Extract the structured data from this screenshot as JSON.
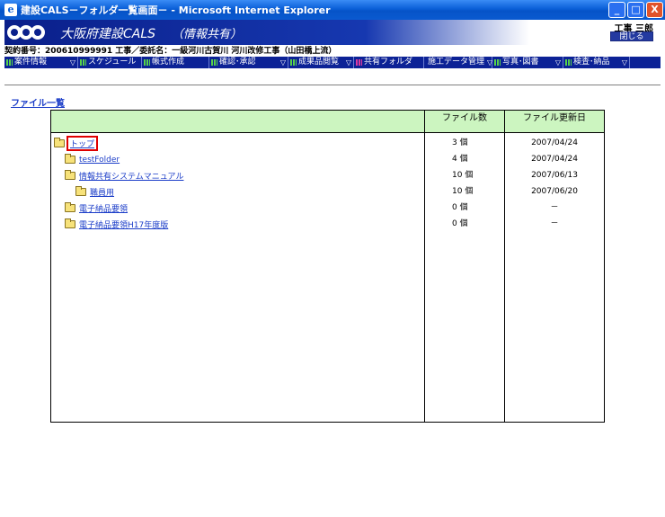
{
  "window": {
    "title": "建設CALS－フォルダ一覧画面－ - Microsoft Internet Explorer",
    "minimize": "_",
    "maximize": "□",
    "close": "X"
  },
  "header": {
    "app_title": "大阪府建設CALS",
    "app_subtitle": "（情報共有）",
    "user_name": "工事 三郎",
    "logout_label": "閉じる"
  },
  "contract_line": "契約番号：200610999991 工事／委託名：一級河川古賀川 河川改修工事（山田橋上流）",
  "menu": [
    {
      "label": "案件情報",
      "arrow": "▽",
      "active": false
    },
    {
      "label": "スケジュール",
      "arrow": "",
      "active": false
    },
    {
      "label": "帳式作成",
      "arrow": "",
      "active": false
    },
    {
      "label": "確認･承認",
      "arrow": "▽",
      "active": false
    },
    {
      "label": "成果品閲覧",
      "arrow": "▽",
      "active": false
    },
    {
      "label": "共有フォルダ",
      "arrow": "",
      "active": true
    },
    {
      "label": "施工データ管理",
      "arrow": "▽",
      "active": false
    },
    {
      "label": "写真･図書",
      "arrow": "▽",
      "active": false
    },
    {
      "label": "検査･納品",
      "arrow": "▽",
      "active": false
    }
  ],
  "file_list_link": "ファイル一覧",
  "table": {
    "headers": {
      "name": "",
      "count": "ファイル数",
      "date": "ファイル更新日"
    },
    "rows": [
      {
        "name": "トップ",
        "count": "3 個",
        "date": "2007/04/24",
        "indent": 0,
        "selected": true
      },
      {
        "name": "testFolder",
        "count": "4 個",
        "date": "2007/04/24",
        "indent": 1,
        "selected": false
      },
      {
        "name": "情報共有システムマニュアル",
        "count": "10 個",
        "date": "2007/06/13",
        "indent": 1,
        "selected": false
      },
      {
        "name": "職員用",
        "count": "10 個",
        "date": "2007/06/20",
        "indent": 2,
        "selected": false
      },
      {
        "name": "電子納品要領",
        "count": "0 個",
        "date": "－",
        "indent": 1,
        "selected": false
      },
      {
        "name": "電子納品要領H17年度版",
        "count": "0 個",
        "date": "－",
        "indent": 1,
        "selected": false
      }
    ]
  }
}
